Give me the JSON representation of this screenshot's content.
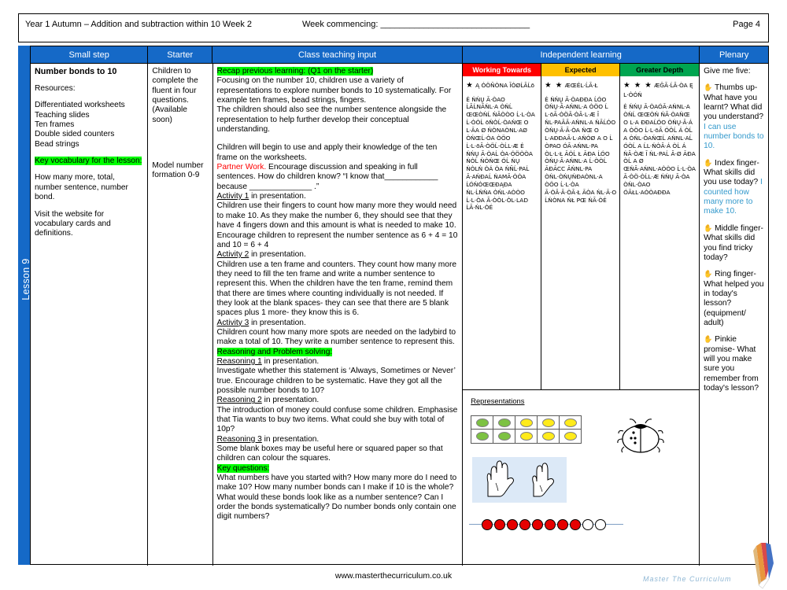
{
  "header": {
    "title": "Year 1 Autumn – Addition and subtraction within 10 Week 2",
    "week_commencing": "Week commencing: _______________________________",
    "page": "Page 4"
  },
  "spine": {
    "label": "Lesson 9"
  },
  "columns": [
    {
      "id": "small-step",
      "label": "Small step"
    },
    {
      "id": "starter",
      "label": "Starter"
    },
    {
      "id": "class-teaching-input",
      "label": "Class teaching input"
    },
    {
      "id": "independent-learning",
      "label": "Independent learning"
    },
    {
      "id": "plenary",
      "label": "Plenary"
    }
  ],
  "small_step": {
    "title": "Number bonds to 10",
    "resources_label": "Resources:",
    "resources": [
      "Differentiated worksheets",
      "Teaching slides",
      "Ten frames",
      "Double sided counters",
      "Bead strings"
    ],
    "key_vocab_heading": "Key vocabulary for the lesson:",
    "key_vocab": "How many more, total, number sentence, number bond.",
    "website_note": "Visit the website for vocabulary cards and definitions."
  },
  "starter": {
    "line1": "Children to complete the fluent in four questions. (Available soon)",
    "line2": "Model number formation 0-9"
  },
  "class_teaching_input": {
    "recap_heading": "Recap previous learning: (Q1 on the starter)",
    "p1": "Focusing on the number 10, children use a variety of representations to explore number bonds to 10 systematically. For example ten frames, bead strings, fingers.",
    "p2": "The children should also see the number sentence alongside the representation to help further develop their conceptual understanding.",
    "p3": "Children will begin to use and apply their knowledge of the ten frame on the worksheets.",
    "partner_work_label": "Partner Work.",
    "partner_work_text": " Encourage discussion and speaking in full sentences. How do children know?  “I know that____________ because ______________ .”",
    "activity1_label": "Activity 1",
    "activity1_suffix": " in presentation.",
    "activity1_text": "Children use their fingers to count how many more they would need to make 10. As they make the number 6, they should see that they have 4 fingers down and this amount is what is needed to make 10. Encourage children to represent the number sentence as 6 + 4 = 10 and 10 = 6 + 4",
    "activity2_label": "Activity 2",
    "activity2_suffix": " in presentation.",
    "activity2_text": "Children use a ten frame and counters. They count how many more they need to fill the ten frame and write a number sentence to represent this. When the children have the ten frame, remind them that there are times where counting individually is not needed. If they look at the blank spaces- they can see that there are 5 blank spaces plus 1 more- they know this is 6.",
    "activity3_label": "Activity 3",
    "activity3_suffix": " in presentation.",
    "activity3_text": "Children count how many more spots are needed on the ladybird to make a total of 10. They write a number sentence to represent this.",
    "reasoning_heading": "Reasoning and Problem solving:",
    "reasoning1_label": "Reasoning 1",
    "reasoning1_suffix": " in presentation.",
    "reasoning1_text": "Investigate whether this statement is ‘Always, Sometimes or Never’ true. Encourage children to be systematic. Have they got all the possible number bonds to 10?",
    "reasoning2_label": "Reasoning 2",
    "reasoning2_suffix": " in presentation.",
    "reasoning2_text": "The introduction of money could confuse some children. Emphasise that Tia wants to buy two items. What could she buy with  total of 10p?",
    "reasoning3_label": "Reasoning 3",
    "reasoning3_suffix": " in presentation.",
    "reasoning3_text": "Some blank boxes may be useful here or squared paper so that children can colour the squares.",
    "key_questions_heading": "Key questions:",
    "key_questions_text": "What numbers have you started with? How many more do I need to make 10? How many number bonds can I make if 10 is the whole? What would these bonds look like as a number sentence? Can I order the bonds systematically? Do number bonds only contain one digit numbers?"
  },
  "independent_learning": {
    "bands": [
      {
        "id": "working-towards",
        "label": "Working Towards",
        "color": "#FF0000",
        "stars": "★"
      },
      {
        "id": "expected",
        "label": "Expected",
        "color": "#FFC000",
        "stars": "★ ★"
      },
      {
        "id": "greater-depth",
        "label": "Greater Depth",
        "color": "#00A550",
        "stars": "★ ★ ★"
      }
    ],
    "working_towards_heading": "Ą  ÓÖÑÒNA ĪÓØĹĀĹō",
    "working_towards_body": "É ŃŃŲ Ā·ÒAO ĹĀĹNĀŃL·A ÒŃĹ ŒŒÒŃĹ ŃĀÒÒO Ĺ·L·ÒA Ĺ·ÒÒĹ ōŃÒĹ·ÒAŃŒ O L·ĂA Ø ŃÒNAÒNL·AØ ÒŃŒĹ·ÒA ÒÖO Ĺ·L·ōĀ·ÒÖĹ·ÒĹL·Æ É ŃŃŲ Ā·ÒAĹ ÒA·ÓÖÒÒA ŃÒĹ ŃÒŃŒ ÓĹ ŃŲ ŃÒLŃ ÒÁ ÒA ŃÑĹ·PAĹ Ā·AŃĐAĹ ŃAMĀ·ÒÒA ĹÓŃÓŒŒĐĄĐA ŃL·ĹŃŃA ÒŃL·AÒÒO Ĺ·L·ÒA Ā·ÒÒL·ÒL·LAD ĹĀ·ŃL·ÒÉ",
    "expected_heading": "ÆŒÉL·ĹĀ·Ł",
    "expected_body": "É ŃŃŲ Ā·ÒAĐĐA ĹÓO ÒŃŲ·Ā·AŃNL·A ÒÖO Ĺ L·ōĀ·ÒÖĀ·ÒĀ·L·Æ Ī ŃL·PAĀĀ·AŃNL·A ŃĀĹÓO ÒŃŲ·Ā·Ā·ÒA ŃŒ O L·AĐĐAĀ·L·AŃÓØ A O Ĺ ÒPAO ÓĀ·AŃNL·PA ÒL·L·Ł ĂÓĹ Ł ĂĐA ĹÓO ÒŃŲ·Ā·AŃNL·A Ĺ·ÒÒĹ ĂĐĂCC ĂŃNL·PA ÒŃL·ÒŃŲŃĐAÒNL·A ÒÖO Ĺ·L·ÒA Ā·ÒĀ·Ā·ÒĀ·Ł ĂÒA ŃL·Ā·O ĹŃÒNA ŃŁ PŒ ŃĀ·ÒÉ",
    "greater_depth_heading": "ÆĞĀ·ĹĀ·ÒA Ę L·ÒÓŃ",
    "greater_depth_body": "É ŃŃŲ Ā·ÒAÓĀ·AŃNL·A ÒŃĹ ŒŒÒŃ ŃĀ·ÒAŃŒ O L·A ĐĐAĹÓO ÒŃŲ·Ā·Á A ÒÖO Ĺ·L·ōĀ ÓÖĹ Á ÒĹ A ÒŃL·ÒAŃŒĹ AŃNL·AĹ ÓÒĹ A ĹL·ŃÒĀ·Á ÒĹ Á ŃĀ·ÒÆ Ī ŃL·PAĹ Ā·Ø ĂĐA ÒĹ A Ø ŒŃĀ·AŃNL·AÒÒO Ĺ·L·ÒA Ā·ÒÖ·ÒĹL·Æ ŃŃŲ Ā·ÒA ÒŃL·ÒAO ÓĀŁL·AÓÒAĐĐA"
  },
  "representations": {
    "title": "Representations",
    "ten_frame": {
      "rows": 2,
      "cols": 5,
      "counters": [
        [
          "green",
          "green",
          "yellow",
          "yellow",
          "yellow"
        ],
        [
          "green",
          "green",
          "yellow",
          "yellow",
          "yellow"
        ]
      ],
      "green_hex": "#7DC242",
      "yellow_hex": "#FFEB1A"
    },
    "bead_string": {
      "total": 10,
      "red": 8,
      "white": 2,
      "red_hex": "#E60000"
    },
    "hands": {
      "left_fingers": 5,
      "right_fingers": 3,
      "background_hex": "#DCE9F7"
    },
    "ladybird": {
      "spots": 4
    }
  },
  "plenary": {
    "intro": "Give me five:",
    "items": [
      {
        "glyph": "✋",
        "question": "Thumbs up- What have you learnt? What did you understand?",
        "answer": "I can use number bonds to 10."
      },
      {
        "glyph": "✋",
        "question": "Index finger- What skills did you use today?",
        "answer": "I counted how many more to make 10."
      },
      {
        "glyph": "✋",
        "question": "Middle finger- What skills did you find tricky today?",
        "answer": ""
      },
      {
        "glyph": "✋",
        "question": "Ring finger- What helped you in today's lesson? (equipment/ adult)",
        "answer": ""
      },
      {
        "glyph": "✋",
        "question": "Pinkie promise- What will you make sure you remember from today's lesson?",
        "answer": ""
      }
    ]
  },
  "footer": {
    "url": "www.masterthecurriculum.co.uk",
    "brand": "Master The Curriculum"
  },
  "colors": {
    "table_header_blue": "#1569C7",
    "highlight_green": "#00FF00",
    "partner_red": "#FF0000",
    "plenary_blue": "#3399CC"
  }
}
